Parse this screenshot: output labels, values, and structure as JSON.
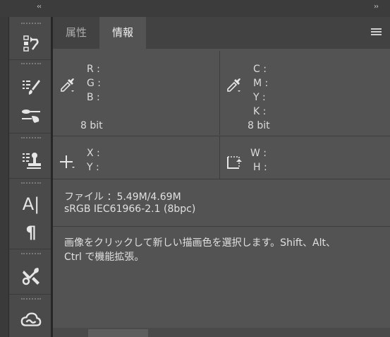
{
  "window": {
    "collapse_left": "‹‹",
    "collapse_right": "››"
  },
  "toolbar": {
    "items": [
      {
        "name": "history-icon"
      },
      {
        "name": "brush-settings-icon"
      },
      {
        "name": "brush-presets-icon"
      },
      {
        "name": "clone-source-icon"
      },
      {
        "name": "character-icon",
        "label": "A|"
      },
      {
        "name": "paragraph-icon",
        "label": "¶"
      },
      {
        "name": "tool-presets-icon"
      },
      {
        "name": "creative-cloud-icon"
      }
    ]
  },
  "tabs": [
    {
      "label": "属性",
      "active": false
    },
    {
      "label": "情報",
      "active": true
    }
  ],
  "info": {
    "rgb": {
      "labels": [
        "R :",
        "G :",
        "B :"
      ],
      "bit": "8 bit"
    },
    "cmyk": {
      "labels": [
        "C :",
        "M :",
        "Y :",
        "K :"
      ],
      "bit": "8 bit"
    },
    "xy": {
      "labels": [
        "X :",
        "Y :"
      ]
    },
    "wh": {
      "labels": [
        "W :",
        "H :"
      ]
    },
    "file": "ファイル ：5.49M/4.69M",
    "profile": "sRGB IEC61966-2.1 (8bpc)",
    "help_line1": "画像をクリックして新しい描画色を選択します。Shift、Alt、",
    "help_line2": "Ctrl で機能拡張。"
  },
  "colors": {
    "panel_bg": "#535353",
    "toolbar_bg": "#4a4a4a",
    "tab_bar_bg": "#424242",
    "text": "#dcdcdc"
  }
}
